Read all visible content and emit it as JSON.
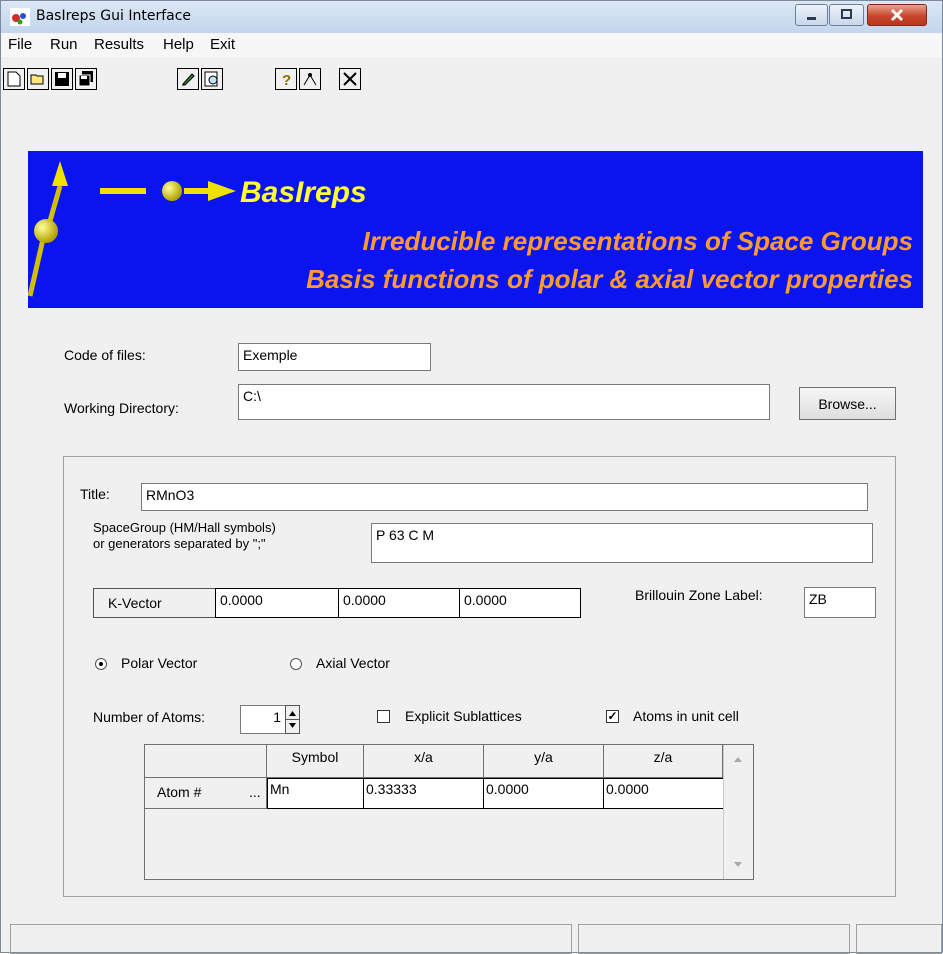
{
  "window": {
    "title": "BasIreps Gui Interface"
  },
  "menu": [
    "File",
    "Run",
    "Results",
    "Help",
    "Exit"
  ],
  "toolbar": {
    "icons": [
      "new-file-icon",
      "open-folder-icon",
      "save-icon",
      "save-all-icon",
      "edit-pen-icon",
      "preview-icon",
      "help-icon",
      "wizard-icon",
      "close-x-icon"
    ]
  },
  "banner": {
    "title": "BasIreps",
    "line1": "Irreducible representations of Space Groups",
    "line2": "Basis functions of polar & axial vector properties",
    "colors": {
      "background": "#0a14ef",
      "title": "#ffff33",
      "subtitle": "#ff9933"
    }
  },
  "files": {
    "code_label": "Code of files:",
    "code_value": "Exemple",
    "dir_label": "Working Directory:",
    "dir_value": "C:\\",
    "browse_label": "Browse..."
  },
  "form": {
    "title_label": "Title:",
    "title_value": "RMnO3",
    "spacegroup_label1": "SpaceGroup (HM/Hall symbols)",
    "spacegroup_label2": "or generators separated by \";\"",
    "spacegroup_value": "P 63 C M",
    "kvector_label": "K-Vector",
    "kvector": [
      "0.0000",
      "0.0000",
      "0.0000"
    ],
    "bz_label": "Brillouin Zone Label:",
    "bz_value": "ZB",
    "polar_label": "Polar Vector",
    "polar_selected": true,
    "axial_label": "Axial Vector",
    "axial_selected": false,
    "natoms_label": "Number of Atoms:",
    "natoms_value": "1",
    "explicit_label": "Explicit Sublattices",
    "explicit_checked": false,
    "unitcell_label": "Atoms in unit cell",
    "unitcell_checked": true
  },
  "atoms_grid": {
    "headers": [
      "Symbol",
      "x/a",
      "y/a",
      "z/a"
    ],
    "rows": [
      {
        "label": "Atom #",
        "ellipsis": "...",
        "symbol": "Mn",
        "x": "0.33333",
        "y": "0.0000",
        "z": "0.0000"
      }
    ]
  }
}
